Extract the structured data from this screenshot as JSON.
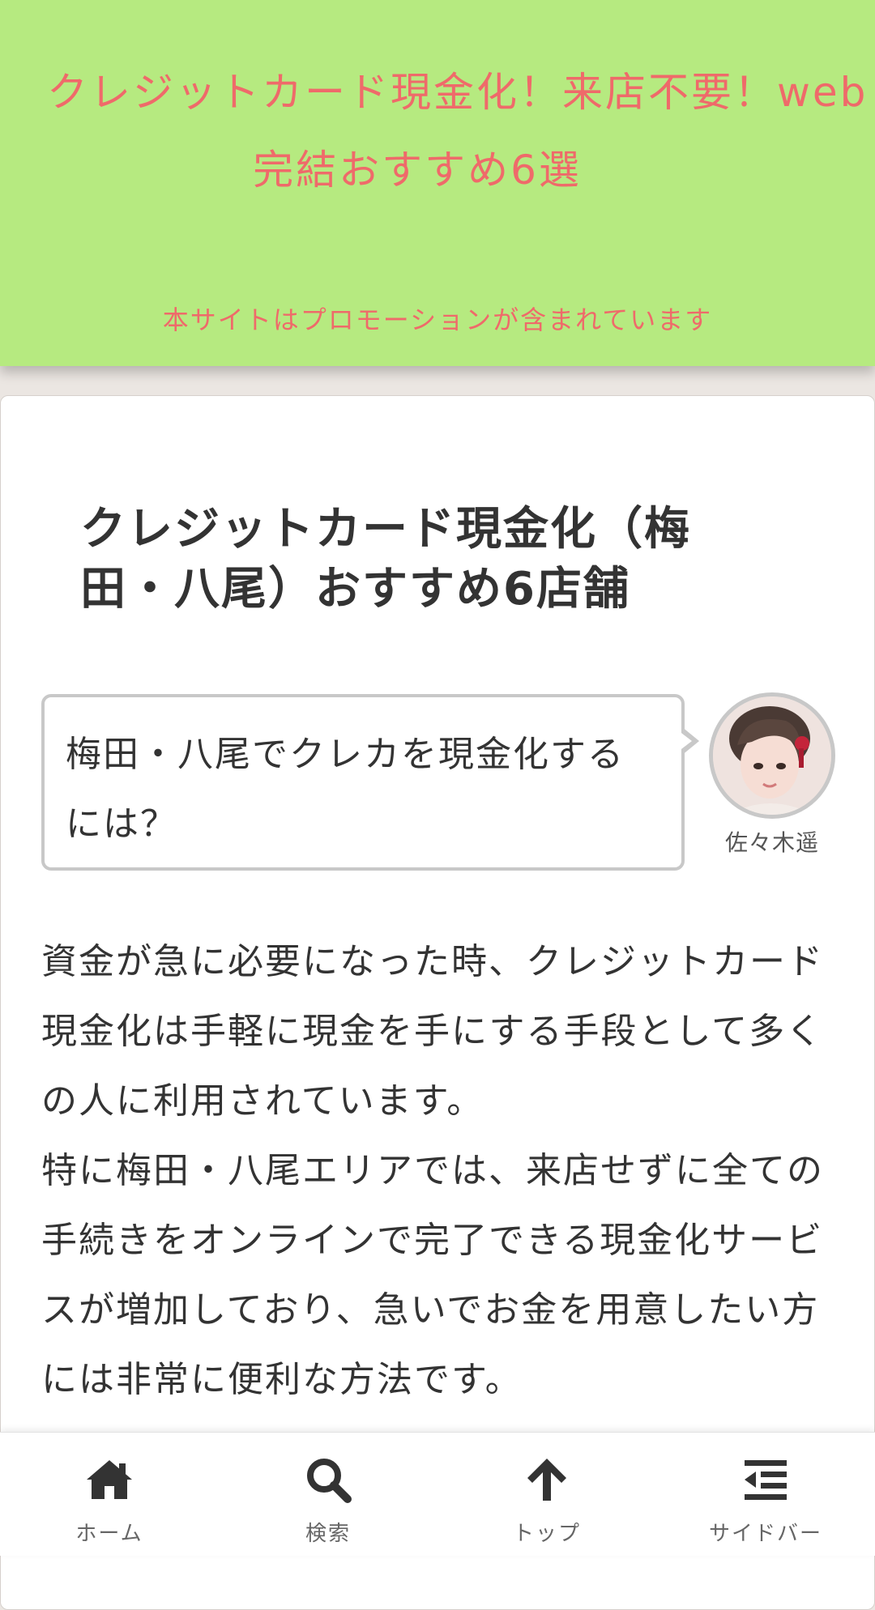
{
  "header": {
    "title_line1": "クレジットカード現金化！来店不要！web",
    "title_line2": "完結おすすめ6選",
    "promo_note": "本サイトはプロモーションが含まれています"
  },
  "article": {
    "title_line1": "クレジットカード現金化（梅",
    "title_line2": "田・八尾）おすすめ6店舗",
    "balloon": {
      "text_line1": "梅田・八尾でクレカを現金化する",
      "text_line2": "には？",
      "speaker_name": "佐々木遥"
    },
    "paragraphs": [
      "資金が急に必要になった時、クレジットカード現金化は手軽に現金を手にする手段として多くの人に利用されています。",
      "特に梅田・八尾エリアでは、来店せずに全ての手続きをオンラインで完了できる現金化サービスが増加しており、急いでお金を用意したい方には非常に便利な方法です。"
    ]
  },
  "bottom_nav": {
    "items": [
      {
        "label": "ホーム",
        "icon": "home-icon"
      },
      {
        "label": "検索",
        "icon": "search-icon"
      },
      {
        "label": "トップ",
        "icon": "arrow-up-icon"
      },
      {
        "label": "サイドバー",
        "icon": "sidebar-icon"
      }
    ]
  },
  "colors": {
    "header_bg": "#b6ea80",
    "accent_text": "#ef6a6a",
    "balloon_border": "#c8c8c8"
  }
}
